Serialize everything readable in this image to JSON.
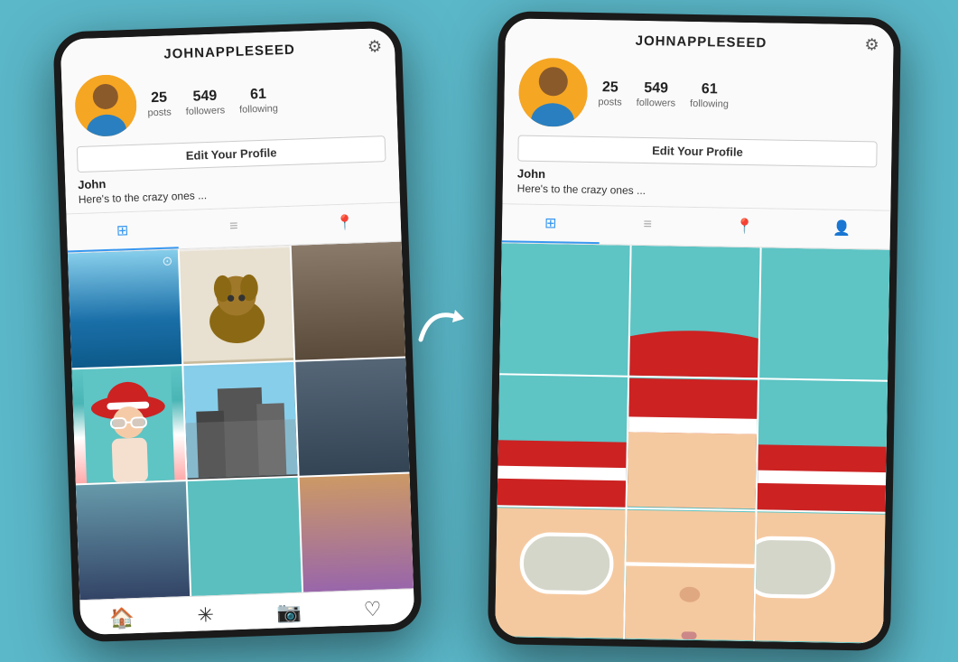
{
  "left_phone": {
    "username": "JOHNAPPLESEED",
    "stats": [
      {
        "number": "25",
        "label": "posts"
      },
      {
        "number": "549",
        "label": "followers"
      },
      {
        "number": "61",
        "label": "following"
      }
    ],
    "edit_button": "Edit Your Profile",
    "bio_name": "John",
    "bio_text": "Here's to the crazy ones ...",
    "tabs": [
      "grid",
      "list",
      "location"
    ],
    "active_tab": "grid"
  },
  "right_phone": {
    "username": "JOHNAPPLESEED",
    "stats": [
      {
        "number": "25",
        "label": "posts"
      },
      {
        "number": "549",
        "label": "followers"
      },
      {
        "number": "61",
        "label": "following"
      }
    ],
    "edit_button": "Edit Your Profile",
    "bio_name": "John",
    "bio_text": "Here's to the crazy ones ...",
    "tabs": [
      "grid",
      "list",
      "location",
      "person"
    ],
    "active_tab": "grid"
  },
  "arrow": "→"
}
